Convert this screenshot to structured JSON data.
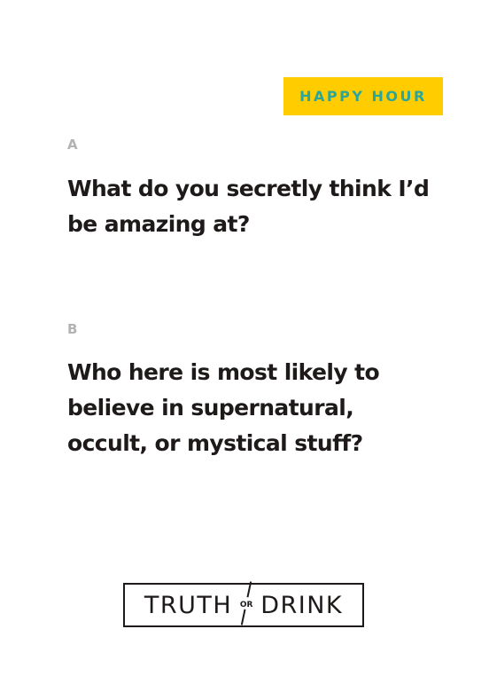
{
  "badge": {
    "label": "HAPPY HOUR"
  },
  "card": {
    "option_a": {
      "letter": "A",
      "question": "What do you secretly think I’d be amazing at?"
    },
    "option_b": {
      "letter": "B",
      "question": "Who here is most likely to believe in supernatural, occult, or mystical stuff?"
    }
  },
  "logo": {
    "word_left": "TRUTH",
    "connector": "OR",
    "word_right": "DRINK"
  },
  "colors": {
    "badge_bg": "#FFCC00",
    "badge_text": "#2BA69A",
    "text": "#1F1A1A",
    "letter": "#B3B3B3"
  }
}
